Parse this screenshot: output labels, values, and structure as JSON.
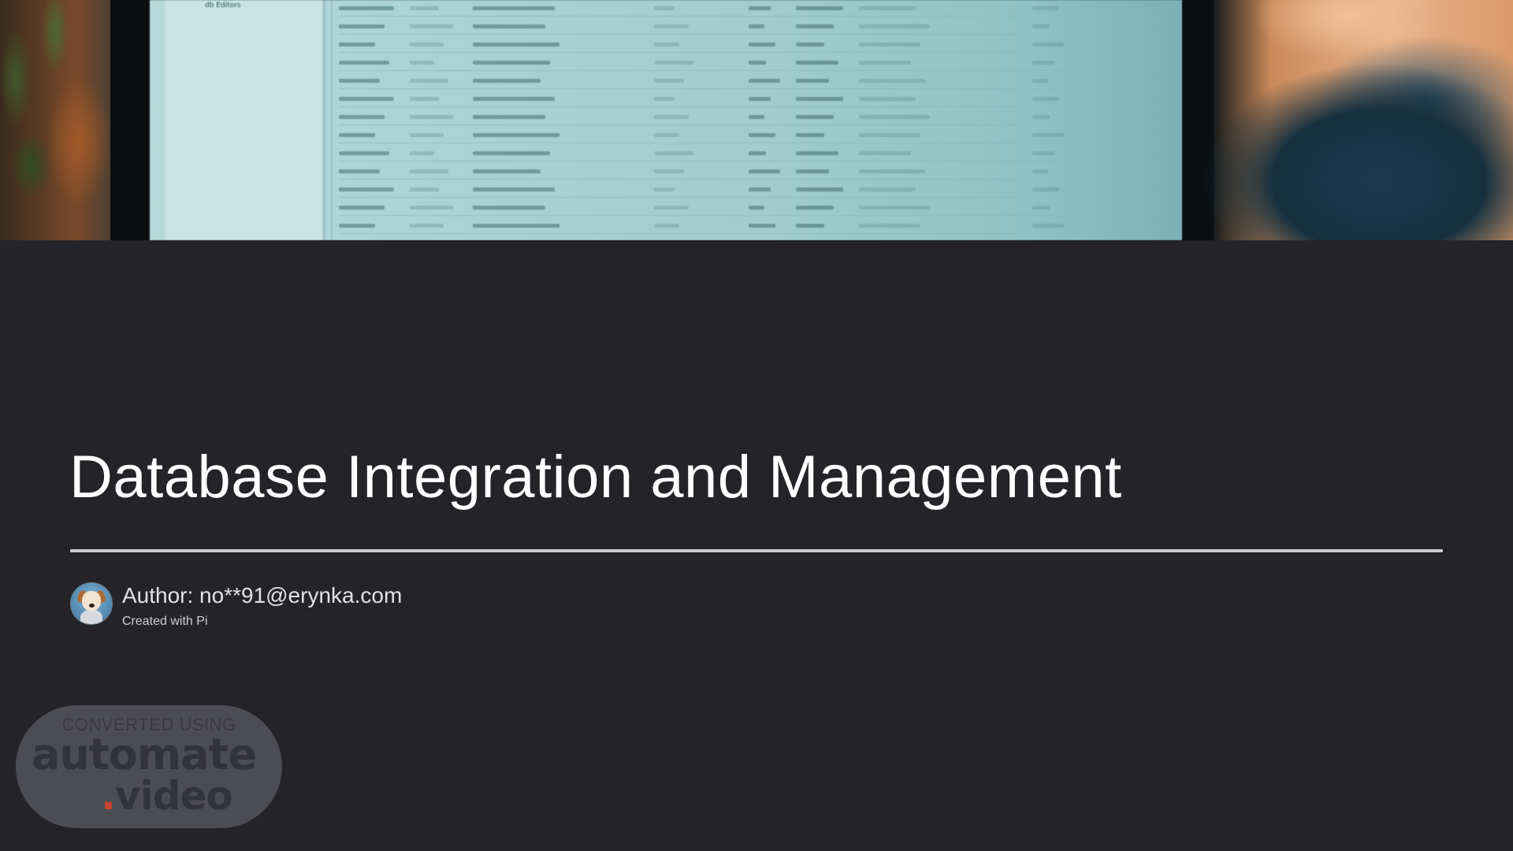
{
  "hero": {
    "screen_sidebar_title": "db Editors"
  },
  "slide": {
    "title": "Database Integration and Management",
    "author": "Author: no**91@erynka.com",
    "created_with": "Created with Pi"
  },
  "watermark": {
    "top": "CONVERTED USING",
    "main": "automate",
    "dot": ".",
    "ext": "video"
  },
  "colors": {
    "background": "#232328",
    "title_text": "#ffffff",
    "divider": "#c9c9cf",
    "watermark_dot": "#c7432f"
  }
}
